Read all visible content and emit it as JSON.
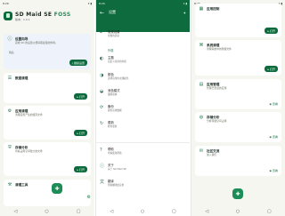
{
  "home": {
    "status_time": "8:26",
    "app_title": "SD Maid SE",
    "app_title_accent": "FOSS",
    "app_version": "版本：1.0.1",
    "cards": [
      {
        "title": "设置向导",
        "desc": "完成 SD 的设置以便获取最佳的体验。",
        "secondary": "稍后",
        "button": "继续设置"
      },
      {
        "title": "数据清理",
        "button": "打开"
      },
      {
        "title": "应用清理",
        "desc": "清理应用产生的缓存文件",
        "button": "打开"
      },
      {
        "title": "存储分析",
        "desc": "查看占用空间较大的文件",
        "button": "打开"
      },
      {
        "title": "清理工具"
      }
    ]
  },
  "settings": {
    "status_time": "8:26",
    "title": "设置",
    "section_labels": [
      "外观"
    ],
    "items": [
      {
        "title": "常规设置",
        "desc": "常规的选项"
      },
      {
        "title": "主题",
        "desc": "自定义应用的外观"
      },
      {
        "title": "颜色",
        "desc": "选择应用的主题颜色"
      },
      {
        "title": "深色模式",
        "desc": "跟随系统"
      },
      {
        "title": "备份",
        "desc": "备份应用数据"
      },
      {
        "title": "更新",
        "desc": "检查更新"
      },
      {
        "title": "帮助",
        "desc": "查看使用帮助"
      },
      {
        "title": "关于",
        "desc": "关于 SD Maid SE"
      },
      {
        "title": "翻译",
        "desc": "帮助翻译此应用"
      }
    ]
  },
  "features": {
    "status_time": "8:26",
    "cards": [
      {
        "title": "应用控制",
        "button": "打开"
      },
      {
        "title": "系统清理",
        "desc": "清理系统中的残留文件",
        "button": "打开"
      },
      {
        "title": "应用管理",
        "desc": "管理已安装的应用",
        "button": "查看"
      },
      {
        "title": "存储分析",
        "desc": "分析存储空间占用",
        "button": "查看"
      },
      {
        "title": "社区交流",
        "desc": "加入我们",
        "button": "查看"
      }
    ]
  },
  "colors": {
    "accent": "#0e6b3d",
    "fab": "#1e8c57",
    "background": "#f6f6f1"
  }
}
